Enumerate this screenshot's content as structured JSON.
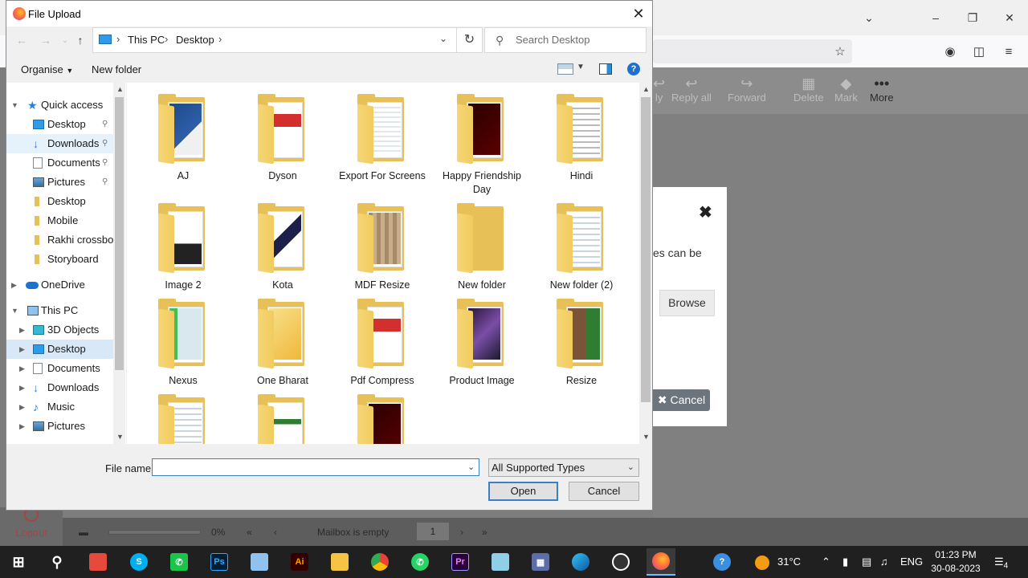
{
  "background": {
    "toolbar": {
      "reply_label": "ly",
      "reply_all_label": "Reply all",
      "forward_label": "Forward",
      "delete_label": "Delete",
      "mark_label": "Mark",
      "more_label": "More"
    },
    "dialog": {
      "text": "es can be",
      "browse_label": "Browse",
      "cancel_label": "Cancel"
    },
    "status": {
      "logout_label": "Logout",
      "progress_text": "0%",
      "mailbox_text": "Mailbox is empty",
      "page_value": "1"
    }
  },
  "dialog": {
    "title": "File Upload",
    "breadcrumb": [
      "This PC",
      "Desktop"
    ],
    "search_placeholder": "Search Desktop",
    "organise_label": "Organise",
    "new_folder_label": "New folder",
    "nav_items": [
      {
        "label": "Quick access",
        "icon": "star-icon",
        "pinned": false
      },
      {
        "label": "Desktop",
        "icon": "desktop-icon",
        "pinned": true
      },
      {
        "label": "Downloads",
        "icon": "download-icon",
        "pinned": true
      },
      {
        "label": "Documents",
        "icon": "document-icon",
        "pinned": true
      },
      {
        "label": "Pictures",
        "icon": "pictures-icon",
        "pinned": true
      },
      {
        "label": "Desktop",
        "icon": "folder-icon",
        "pinned": false
      },
      {
        "label": "Mobile",
        "icon": "folder-icon",
        "pinned": false
      },
      {
        "label": "Rakhi crossbon",
        "icon": "folder-icon",
        "pinned": false
      },
      {
        "label": "Storyboard",
        "icon": "folder-icon",
        "pinned": false
      },
      {
        "label": "OneDrive",
        "icon": "cloud-icon",
        "pinned": false
      },
      {
        "label": "This PC",
        "icon": "computer-icon",
        "pinned": false
      },
      {
        "label": "3D Objects",
        "icon": "cube-icon",
        "pinned": false
      },
      {
        "label": "Desktop",
        "icon": "desktop-icon",
        "pinned": false
      },
      {
        "label": "Documents",
        "icon": "document-icon",
        "pinned": false
      },
      {
        "label": "Downloads",
        "icon": "download-icon",
        "pinned": false
      },
      {
        "label": "Music",
        "icon": "music-icon",
        "pinned": false
      },
      {
        "label": "Pictures",
        "icon": "pictures-icon",
        "pinned": false
      }
    ],
    "files": [
      {
        "name": "AJ"
      },
      {
        "name": "Dyson"
      },
      {
        "name": "Export For Screens"
      },
      {
        "name": "Happy Friendship Day"
      },
      {
        "name": "Hindi"
      },
      {
        "name": "Image 2"
      },
      {
        "name": "Kota"
      },
      {
        "name": "MDF Resize"
      },
      {
        "name": "New folder"
      },
      {
        "name": "New folder (2)"
      },
      {
        "name": "Nexus"
      },
      {
        "name": "One Bharat"
      },
      {
        "name": "Pdf Compress"
      },
      {
        "name": "Product Image"
      },
      {
        "name": "Resize"
      },
      {
        "name": ""
      },
      {
        "name": ""
      },
      {
        "name": ""
      }
    ],
    "file_name_label": "File name:",
    "file_name_value": "",
    "file_type_value": "All Supported Types",
    "open_label": "Open",
    "cancel_label": "Cancel"
  },
  "taskbar": {
    "temperature": "31°C",
    "language": "ENG",
    "time": "01:23 PM",
    "date": "30-08-2023",
    "notification_count": "4"
  },
  "colors": {
    "accent": "#3c7fc7",
    "folder": "#e7c057",
    "selection": "#d9e8f7",
    "taskbar": "#202020"
  }
}
